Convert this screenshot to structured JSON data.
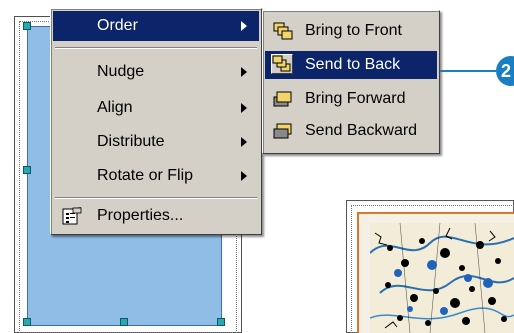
{
  "context_menu": {
    "items": [
      {
        "label": "Order",
        "has_submenu": true,
        "selected": true
      },
      {
        "label": "Nudge",
        "has_submenu": true
      },
      {
        "label": "Align",
        "has_submenu": true
      },
      {
        "label": "Distribute",
        "has_submenu": true
      },
      {
        "label": "Rotate or Flip",
        "has_submenu": true
      }
    ],
    "properties": {
      "label": "Properties...",
      "icon": "properties-icon"
    }
  },
  "order_submenu": {
    "items": [
      {
        "label": "Bring to Front",
        "icon": "bring-to-front-icon"
      },
      {
        "label": "Send to Back",
        "icon": "send-to-back-icon",
        "selected": true
      },
      {
        "label": "Bring Forward",
        "icon": "bring-forward-icon"
      },
      {
        "label": "Send Backward",
        "icon": "send-backward-icon"
      }
    ]
  },
  "callout": {
    "number": "2"
  },
  "colors": {
    "menu_bg": "#d4d0c8",
    "highlight": "#0b246a",
    "frame_fill": "#8fbde6",
    "callout": "#1a7fc2",
    "map_border": "#d9772e"
  }
}
